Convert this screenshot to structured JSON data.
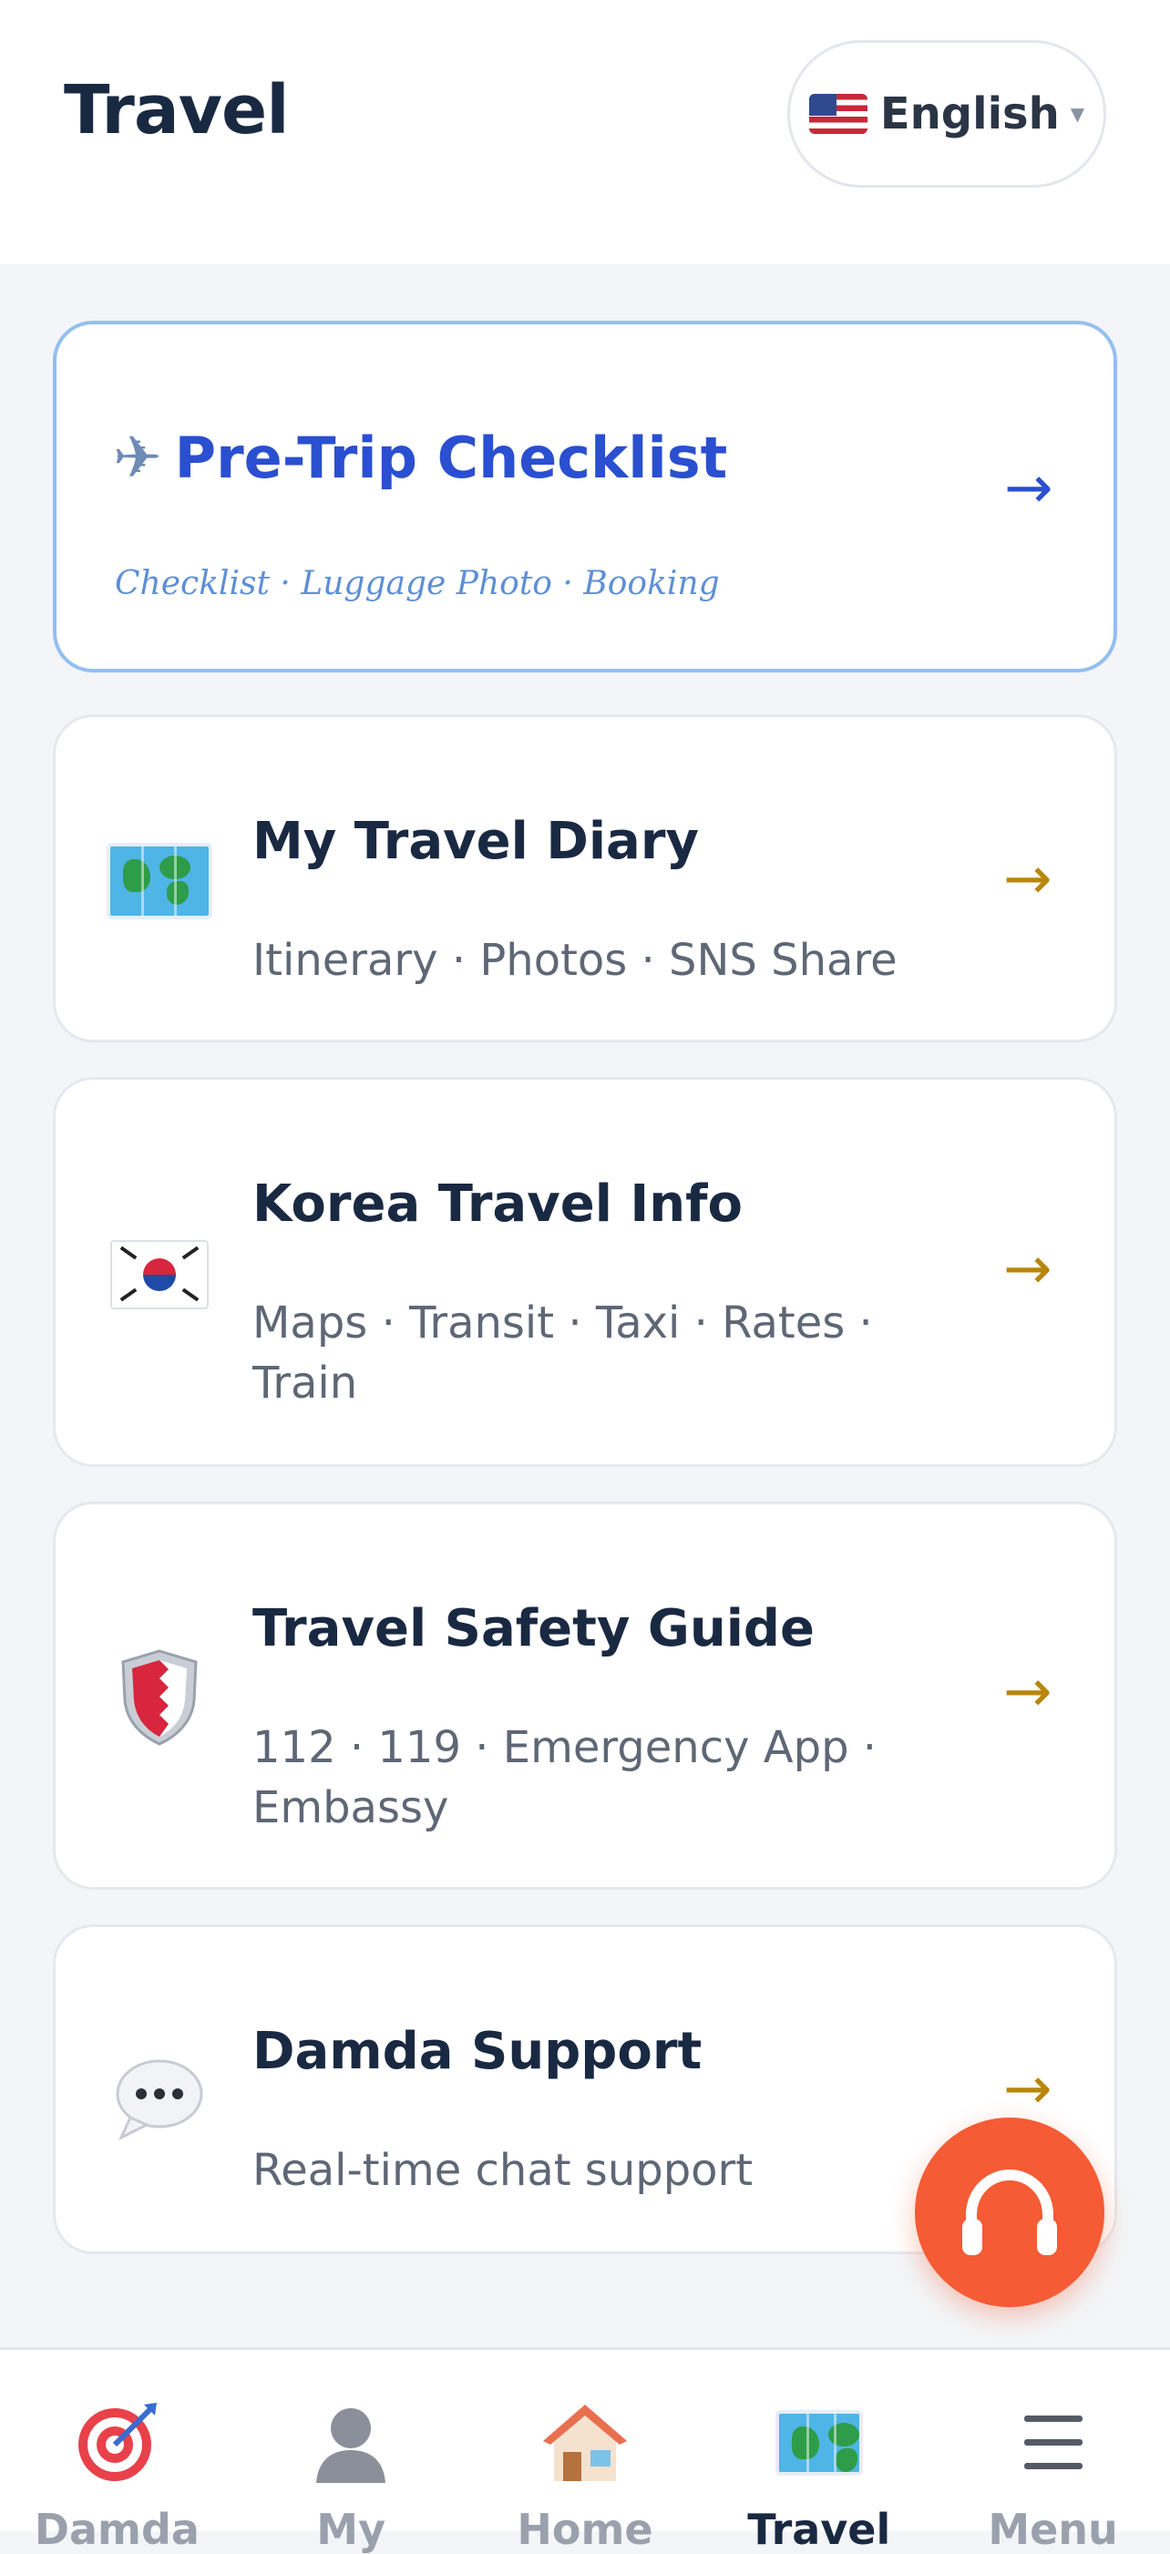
{
  "header": {
    "title": "Travel",
    "language": {
      "label": "English",
      "flag_icon": "us-flag-icon",
      "caret_icon": "caret-down-icon"
    }
  },
  "cards": [
    {
      "title": "Pre-Trip Checklist",
      "subtitle": "Checklist · Luggage Photo · Booking",
      "icon": "airplane-icon",
      "arrow": "→",
      "featured": true
    },
    {
      "title": "My Travel Diary",
      "subtitle": "Itinerary · Photos · SNS Share",
      "icon": "world-map-icon",
      "arrow": "→"
    },
    {
      "title": "Korea Travel Info",
      "subtitle": "Maps · Transit · Taxi · Rates · Train",
      "icon": "korea-flag-icon",
      "arrow": "→"
    },
    {
      "title": "Travel Safety Guide",
      "subtitle": "112 · 119 · Emergency App · Embassy",
      "icon": "shield-icon",
      "arrow": "→"
    },
    {
      "title": "Damda Support",
      "subtitle": "Real-time chat support",
      "icon": "speech-bubble-icon",
      "arrow": "→"
    }
  ],
  "fab": {
    "icon": "headphones-icon"
  },
  "nav": {
    "active": "Travel",
    "items": [
      {
        "label": "Damda",
        "icon": "target-icon"
      },
      {
        "label": "My",
        "icon": "person-icon"
      },
      {
        "label": "Home",
        "icon": "house-icon"
      },
      {
        "label": "Travel",
        "icon": "world-map-icon"
      },
      {
        "label": "Menu",
        "icon": "hamburger-icon"
      }
    ]
  },
  "colors": {
    "accent_blue": "#2a4fd0",
    "accent_gold": "#b8860b",
    "fab_orange": "#f55b34",
    "title_navy": "#1a2942",
    "background": "#f3f5f8"
  }
}
